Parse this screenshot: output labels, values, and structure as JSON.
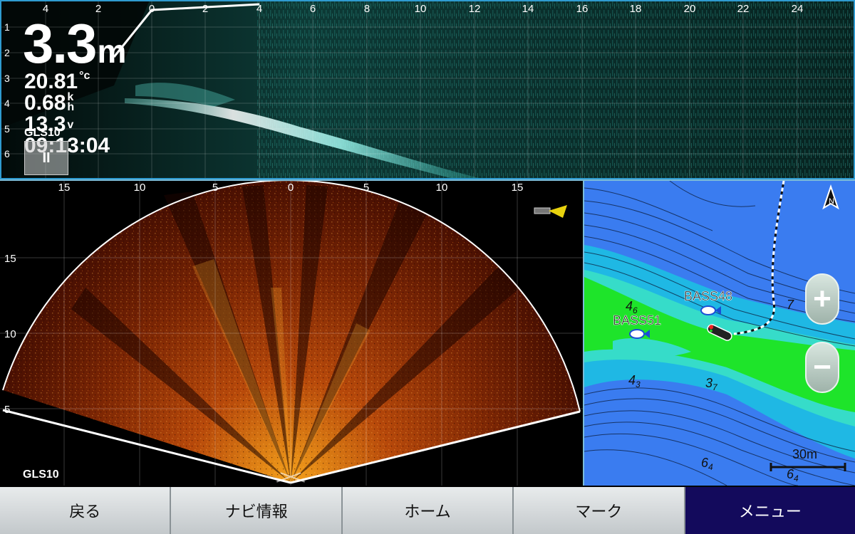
{
  "top_panel": {
    "x_ticks": [
      "4",
      "2",
      "0",
      "2",
      "4",
      "6",
      "8",
      "10",
      "12",
      "14",
      "16",
      "18",
      "20",
      "22",
      "24"
    ],
    "y_ticks": [
      "1",
      "2",
      "3",
      "4",
      "5",
      "6"
    ],
    "depth_value": "3.3",
    "depth_unit": "m",
    "water_temp_value": "20.81",
    "water_temp_unit": "°c",
    "speed_value": "0.68",
    "speed_unit": "k h",
    "voltage_value": "13.3",
    "voltage_unit": "v",
    "source_label": "GLS10",
    "time": "09:13:04",
    "pause_label": "II"
  },
  "sonar_panel": {
    "x_ticks": [
      "15",
      "10",
      "5",
      "0",
      "5",
      "10",
      "15"
    ],
    "y_ticks": [
      "15",
      "10",
      "5"
    ],
    "source_label": "GLS10",
    "colors": {
      "fan_dark": "#3b0b02",
      "fan_mid": "#8a2a05",
      "fan_bright": "#f5a21b"
    }
  },
  "map_panel": {
    "compass_label": "N",
    "waypoints": [
      {
        "label": "BASS48"
      },
      {
        "label": "BASS51"
      }
    ],
    "depth_labels": [
      {
        "main": "4",
        "sub": "6"
      },
      {
        "main": "7",
        "sub": ""
      },
      {
        "main": "4",
        "sub": "3"
      },
      {
        "main": "3",
        "sub": "7"
      },
      {
        "main": "6",
        "sub": "4"
      },
      {
        "main": "6",
        "sub": "4"
      }
    ],
    "scale_label": "30m",
    "zoom_in_label": "+",
    "zoom_out_label": "−",
    "colors": {
      "deep": "#3a7cf0",
      "mid": "#1fb8e4",
      "shallow": "#36dcc9",
      "shoal": "#1ee42a"
    }
  },
  "bottom_bar": {
    "back": "戻る",
    "nav_info": "ナビ情報",
    "home": "ホーム",
    "mark": "マーク",
    "menu": "メニュー"
  }
}
